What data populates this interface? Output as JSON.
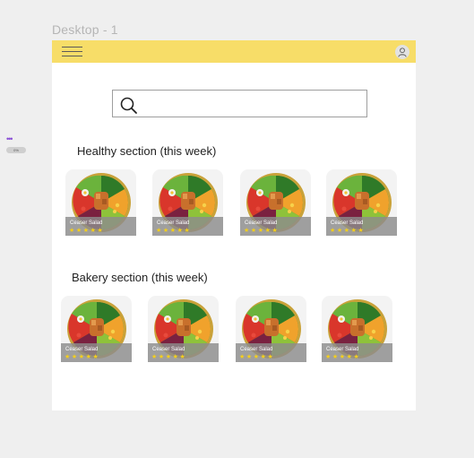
{
  "canvas": {
    "frame_label": "Desktop - 1",
    "side_dots": "•••",
    "side_pill": "0%"
  },
  "header": {
    "menu_icon": "hamburger-menu-icon",
    "profile_icon": "user-avatar-icon",
    "background": "#f7dd68"
  },
  "search": {
    "placeholder": "",
    "icon": "search-icon"
  },
  "sections": [
    {
      "title": "Healthy section (this week)",
      "items": [
        {
          "name": "Ceaser Salad",
          "stars": "★★★★★"
        },
        {
          "name": "Ceaser Salad",
          "stars": "★★★★★"
        },
        {
          "name": "Ceaser Salad",
          "stars": "★★★★★"
        },
        {
          "name": "Ceaser Salad",
          "stars": "★★★★★"
        }
      ]
    },
    {
      "title": "Bakery section (this week)",
      "items": [
        {
          "name": "Ceaser Salad",
          "stars": "★★★★★"
        },
        {
          "name": "Ceaser Salad",
          "stars": "★★★★★"
        },
        {
          "name": "Ceaser Salad",
          "stars": "★★★★★"
        },
        {
          "name": "Ceaser Salad",
          "stars": "★★★★★"
        }
      ]
    }
  ],
  "colors": {
    "star": "#f5cf1b",
    "accent_bar": "#f7dd68"
  }
}
